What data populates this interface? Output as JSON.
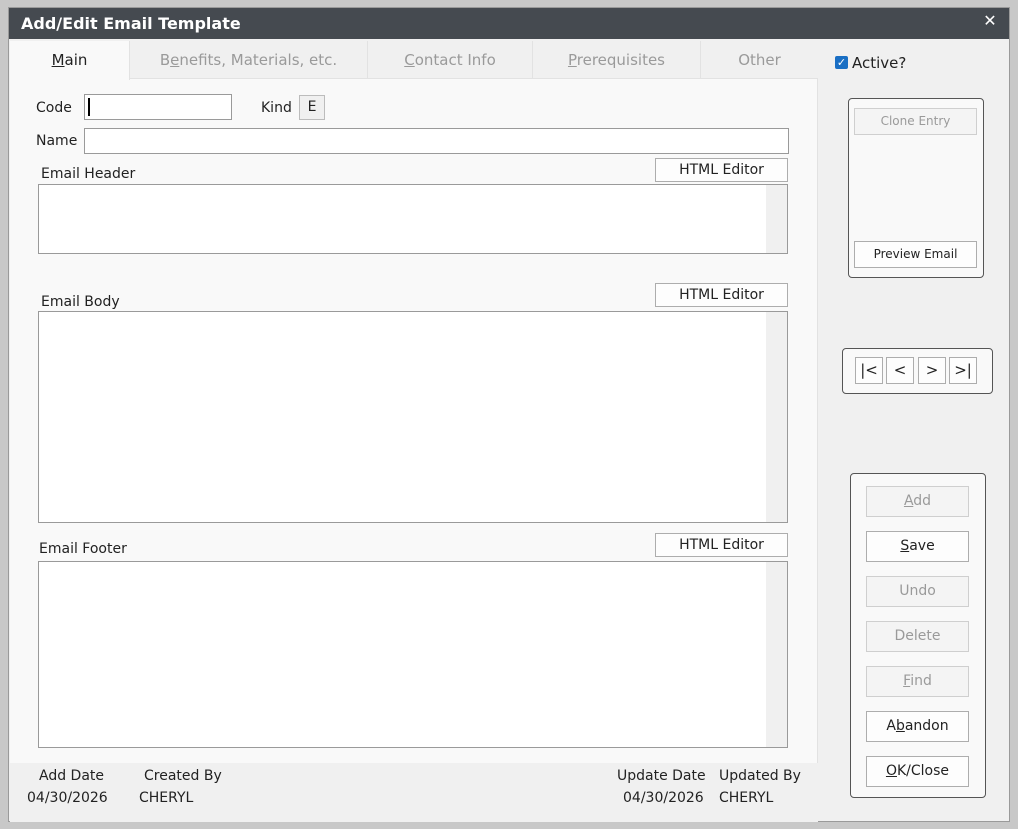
{
  "window": {
    "title": "Add/Edit Email Template",
    "close_glyph": "✕"
  },
  "tabs": [
    {
      "pre": "",
      "ul": "M",
      "post": "ain",
      "active": true
    },
    {
      "pre": "B",
      "ul": "e",
      "post": "nefits, Materials, etc.",
      "active": false
    },
    {
      "pre": "",
      "ul": "C",
      "post": "ontact Info",
      "active": false
    },
    {
      "pre": "",
      "ul": "P",
      "post": "rerequisites",
      "active": false
    },
    {
      "pre": "",
      "ul": "",
      "post": "Other",
      "active": false
    }
  ],
  "form": {
    "code_label": "Code",
    "code_value": "",
    "kind_label": "Kind",
    "kind_value": "E",
    "name_label": "Name",
    "name_value": "",
    "email_header_label": "Email Header",
    "email_body_label": "Email Body",
    "email_footer_label": "Email Footer",
    "html_editor_label": "HTML Editor"
  },
  "footer": {
    "add_date_label": "Add Date",
    "add_date_value": "04/30/2026",
    "created_by_label": "Created By",
    "created_by_value": "CHERYL",
    "update_date_label": "Update Date",
    "update_date_value": "04/30/2026",
    "updated_by_label": "Updated By",
    "updated_by_value": "CHERYL"
  },
  "side": {
    "active_label": "Active?",
    "active_checked": true,
    "clone_entry_label": "Clone Entry",
    "preview_email_label": "Preview Email",
    "nav": {
      "first": "|<",
      "prev": "<",
      "next": ">",
      "last": ">|"
    },
    "actions": {
      "add": {
        "ul": "A",
        "post": "dd"
      },
      "save": {
        "ul": "S",
        "post": "ave"
      },
      "undo": "Undo",
      "delete": "Delete",
      "find": {
        "ul": "F",
        "post": "ind"
      },
      "abandon": {
        "pre": "A",
        "ul": "b",
        "post": "andon"
      },
      "ok_close": {
        "ul": "O",
        "post": "K/Close"
      }
    }
  },
  "colors": {
    "titlebar": "#454a50",
    "checkbox": "#1a6fc4",
    "disabled_text": "#9a9a9a"
  }
}
